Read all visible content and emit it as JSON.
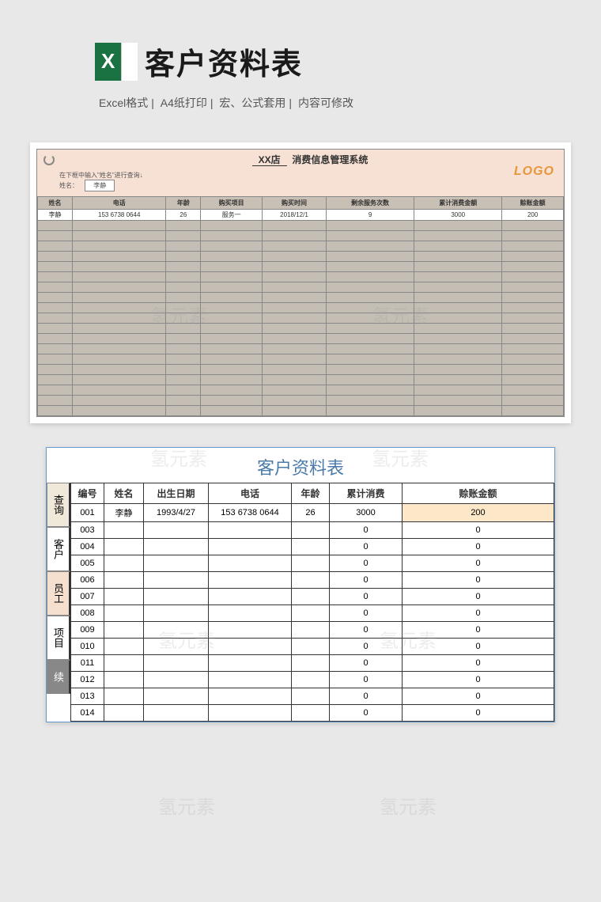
{
  "header": {
    "title": "客户资料表",
    "features": [
      "Excel格式",
      "A4纸打印",
      "宏、公式套用",
      "内容可修改"
    ]
  },
  "sheet1": {
    "title_prefix": "XX店",
    "title_suffix": "消费信息管理系统",
    "logo": "LOGO",
    "search_hint": "在下框中输入\"姓名\"进行查询↓",
    "search_label": "姓名：",
    "search_value": "李静",
    "columns": [
      "姓名",
      "电话",
      "年龄",
      "购买项目",
      "购买时间",
      "剩余服务次数",
      "累计消费金额",
      "赊账金额"
    ],
    "rows": [
      {
        "c0": "李静",
        "c1": "153 6738 0644",
        "c2": "26",
        "c3": "服务一",
        "c4": "2018/12/1",
        "c5": "9",
        "c6": "3000",
        "c7": "200"
      }
    ],
    "empty_row_count": 19
  },
  "sheet2": {
    "title": "客户资料表",
    "tabs": [
      "查询",
      "客户",
      "员工",
      "项目",
      "续"
    ],
    "columns": [
      "编号",
      "姓名",
      "出生日期",
      "电话",
      "年龄",
      "累计消费",
      "赊账金额"
    ],
    "rows": [
      {
        "id": "001",
        "name": "李静",
        "dob": "1993/4/27",
        "phone": "153 6738 0644",
        "age": "26",
        "total": "3000",
        "owed": "200"
      },
      {
        "id": "003",
        "name": "",
        "dob": "",
        "phone": "",
        "age": "",
        "total": "0",
        "owed": "0"
      },
      {
        "id": "004",
        "name": "",
        "dob": "",
        "phone": "",
        "age": "",
        "total": "0",
        "owed": "0"
      },
      {
        "id": "005",
        "name": "",
        "dob": "",
        "phone": "",
        "age": "",
        "total": "0",
        "owed": "0"
      },
      {
        "id": "006",
        "name": "",
        "dob": "",
        "phone": "",
        "age": "",
        "total": "0",
        "owed": "0"
      },
      {
        "id": "007",
        "name": "",
        "dob": "",
        "phone": "",
        "age": "",
        "total": "0",
        "owed": "0"
      },
      {
        "id": "008",
        "name": "",
        "dob": "",
        "phone": "",
        "age": "",
        "total": "0",
        "owed": "0"
      },
      {
        "id": "009",
        "name": "",
        "dob": "",
        "phone": "",
        "age": "",
        "total": "0",
        "owed": "0"
      },
      {
        "id": "010",
        "name": "",
        "dob": "",
        "phone": "",
        "age": "",
        "total": "0",
        "owed": "0"
      },
      {
        "id": "011",
        "name": "",
        "dob": "",
        "phone": "",
        "age": "",
        "total": "0",
        "owed": "0"
      },
      {
        "id": "012",
        "name": "",
        "dob": "",
        "phone": "",
        "age": "",
        "total": "0",
        "owed": "0"
      },
      {
        "id": "013",
        "name": "",
        "dob": "",
        "phone": "",
        "age": "",
        "total": "0",
        "owed": "0"
      },
      {
        "id": "014",
        "name": "",
        "dob": "",
        "phone": "",
        "age": "",
        "total": "0",
        "owed": "0"
      }
    ]
  },
  "watermark": "氢元素"
}
